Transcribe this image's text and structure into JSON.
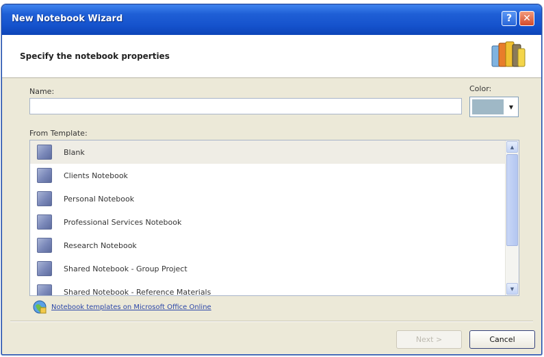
{
  "window": {
    "title": "New Notebook Wizard",
    "help_glyph": "?",
    "close_glyph": "✕"
  },
  "header": {
    "heading": "Specify the notebook properties",
    "icon": "notebooks-icon"
  },
  "form": {
    "name_label": "Name:",
    "name_value": "",
    "color_label": "Color:",
    "color_value": "#9fb8c6",
    "template_label": "From Template:"
  },
  "templates": [
    {
      "label": "Blank",
      "selected": true
    },
    {
      "label": "Clients Notebook",
      "selected": false
    },
    {
      "label": "Personal Notebook",
      "selected": false
    },
    {
      "label": "Professional Services Notebook",
      "selected": false
    },
    {
      "label": "Research Notebook",
      "selected": false
    },
    {
      "label": "Shared Notebook - Group Project",
      "selected": false
    },
    {
      "label": "Shared Notebook - Reference Materials",
      "selected": false
    }
  ],
  "online_link": "Notebook templates on Microsoft Office Online",
  "buttons": {
    "next": "Next >",
    "cancel": "Cancel"
  },
  "colors": {
    "titlebar": "#1552cc",
    "dialog_background": "#ece9d8",
    "selected_row": "#efede5",
    "link": "#2b46a8"
  }
}
